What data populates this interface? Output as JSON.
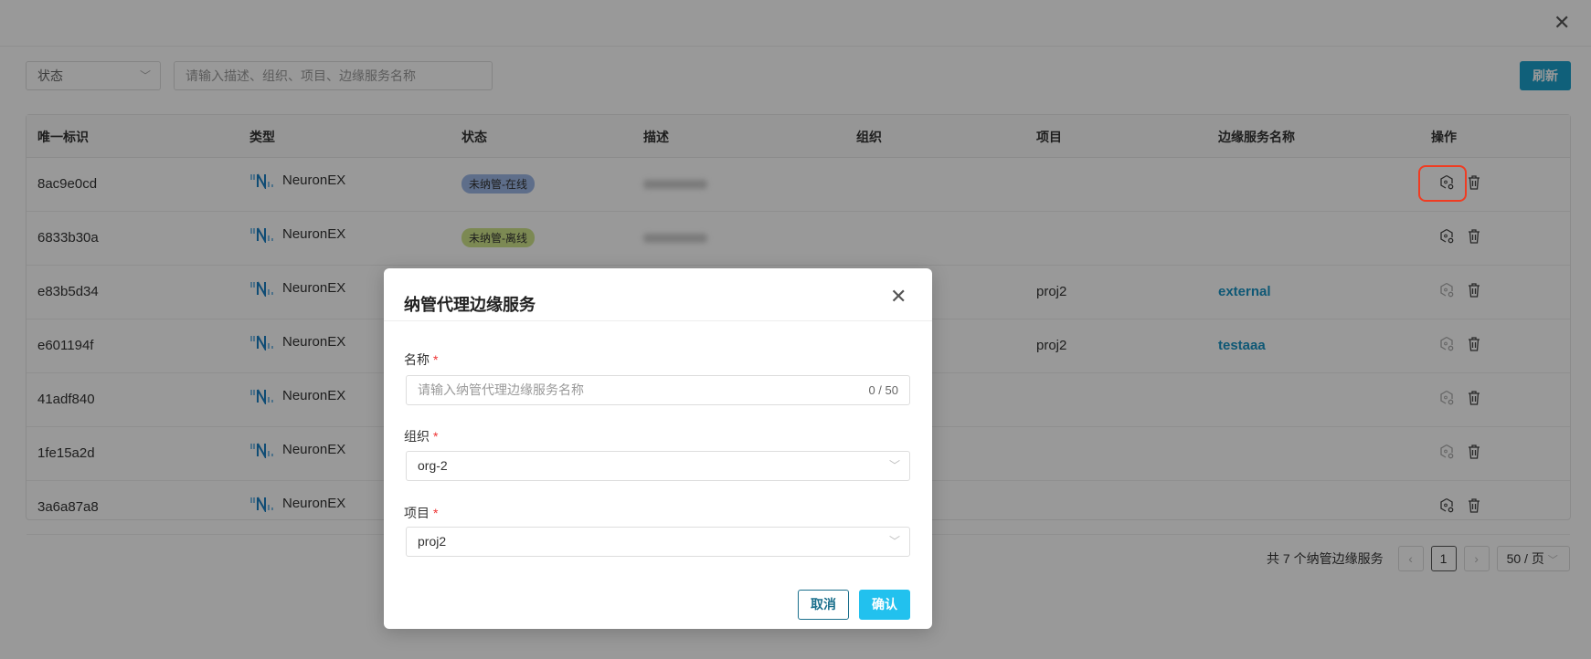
{
  "filter": {
    "status_placeholder": "状态",
    "search_placeholder": "请输入描述、组织、项目、边缘服务名称",
    "refresh_label": "刷新"
  },
  "table": {
    "headers": [
      "唯一标识",
      "类型",
      "状态",
      "描述",
      "组织",
      "项目",
      "边缘服务名称",
      "操作"
    ],
    "rows": [
      {
        "id": "8ac9e0cd",
        "type": "NeuronEX",
        "status": "未纳管-在线",
        "status_color": "#9db8e6",
        "project": "",
        "service": "",
        "manage_enabled": true
      },
      {
        "id": "6833b30a",
        "type": "NeuronEX",
        "status": "未纳管-离线",
        "status_color": "#cfe58a",
        "project": "",
        "service": "",
        "manage_enabled": true
      },
      {
        "id": "e83b5d34",
        "type": "NeuronEX",
        "status": "",
        "project": "proj2",
        "service": "external",
        "manage_enabled": false
      },
      {
        "id": "e601194f",
        "type": "NeuronEX",
        "status": "",
        "project": "proj2",
        "service": "testaaa",
        "manage_enabled": false
      },
      {
        "id": "41adf840",
        "type": "NeuronEX",
        "status": "",
        "project": "",
        "service": "",
        "manage_enabled": false
      },
      {
        "id": "1fe15a2d",
        "type": "NeuronEX",
        "status": "",
        "project": "",
        "service": "",
        "manage_enabled": false
      },
      {
        "id": "3a6a87a8",
        "type": "NeuronEX",
        "status": "",
        "project": "",
        "service": "",
        "manage_enabled": true
      }
    ]
  },
  "pagination": {
    "total_text": "共 7 个纳管边缘服务",
    "current_page": "1",
    "prev": "‹",
    "next": "›",
    "page_size": "50 / 页"
  },
  "modal": {
    "title": "纳管代理边缘服务",
    "name_label": "名称",
    "name_placeholder": "请输入纳管代理边缘服务名称",
    "name_count": "0 / 50",
    "org_label": "组织",
    "org_value": "org-2",
    "project_label": "项目",
    "project_value": "proj2",
    "required_mark": "*",
    "cancel_label": "取消",
    "confirm_label": "确认"
  }
}
